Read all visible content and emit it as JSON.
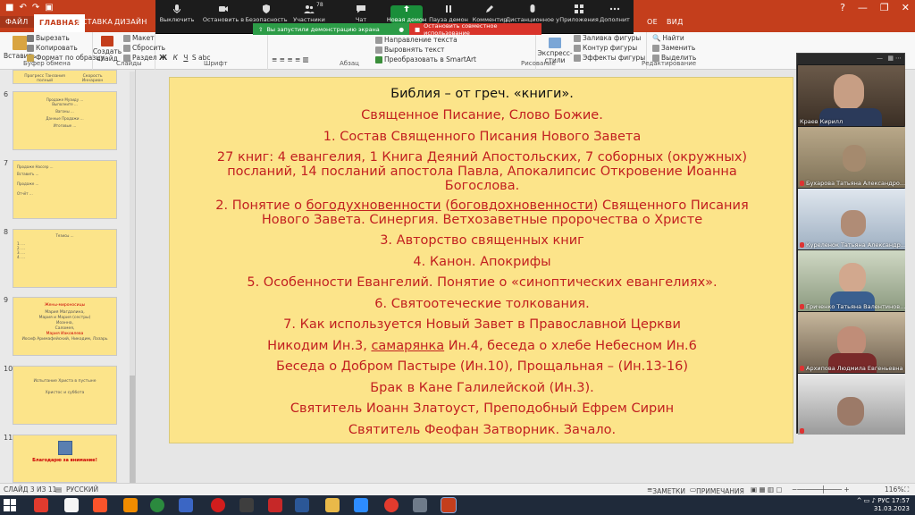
{
  "titlebar": {
    "window_controls": [
      "?",
      "—",
      "❐",
      "✕"
    ]
  },
  "ribbon_tabs": {
    "file": "ФАЙЛ",
    "home": "ГЛАВНАЯ",
    "insert": "ВСТАВКА",
    "design": "ДИЗАЙН",
    "right1": "ОЕ",
    "right2": "ВИД"
  },
  "ribbon": {
    "paste": "Вставить",
    "cut": "Вырезать",
    "copy": "Копировать",
    "format_painter": "Формат по образцу",
    "new_slide": "Создать слайд",
    "layout": "Макет",
    "reset": "Сбросить",
    "section": "Раздел",
    "text_direction": "Направление текста",
    "align_text": "Выровнять текст",
    "smartart": "Преобразовать в SmartArt",
    "shape_fill": "Заливка фигуры",
    "shape_outline": "Контур фигуры",
    "shape_effects": "Эффекты фигуры",
    "quick_styles": "Экспресс-стили",
    "find": "Найти",
    "replace": "Заменить",
    "select": "Выделить"
  },
  "group_labels": {
    "clipboard": "Буфер обмена",
    "slides": "Слайды",
    "font": "Шрифт",
    "paragraph": "Абзац",
    "drawing": "Рисование",
    "editing": "Редактирование"
  },
  "zoom_toolbar": {
    "items": [
      {
        "label": "Выключить"
      },
      {
        "label": "Остановить в"
      },
      {
        "label": "Безопасность"
      },
      {
        "label": "Участники",
        "count": "78"
      },
      {
        "label": "Чат"
      },
      {
        "label": "Новая демон"
      },
      {
        "label": "Пауза демон"
      },
      {
        "label": "Комментир"
      },
      {
        "label": "Дистанционное у"
      },
      {
        "label": "Приложения"
      },
      {
        "label": "Дополнит"
      }
    ],
    "share_notice": "Вы запустили демонстрацию экрана",
    "stop_share": "Остановить совместное использование"
  },
  "thumbnails": [
    {
      "num": "",
      "lines": [
        "Прогресс Танзания полный",
        "Скорость Иннарион"
      ]
    },
    {
      "num": "6",
      "lines": [
        "Продаже Музиду ...",
        "Выполните ...",
        "Вагоны ...",
        "Данные Продажи ...",
        "Итоговые ..."
      ]
    },
    {
      "num": "7",
      "lines": [
        "Продаже Нассер ...",
        "Вставить ...",
        "Продаже ...",
        "Отчёт ..."
      ]
    },
    {
      "num": "8",
      "lines": [
        "Тезисы ...",
        "1. ...",
        "2. ...",
        "3. ...",
        "4. ..."
      ]
    },
    {
      "num": "9",
      "lines": [
        "Жены-мироносицы",
        "Мария Магдалина,",
        "Мария и Мария (сестры)",
        "Иоанна,",
        "Саломея,",
        "Мария Иаковлева",
        "Иосиф Аримафейский, Никодим, Лазарь"
      ]
    },
    {
      "num": "10",
      "lines": [
        "Испытание Христа в пустыне",
        "Христос и суббота"
      ]
    },
    {
      "num": "11",
      "lines": [
        "Благодарю за внимание!"
      ]
    }
  ],
  "slide": {
    "line1": "Библия – от греч. «книги».",
    "line2": "Священное Писание, Слово Божие.",
    "line3": "1. Состав Священного Писания Нового Завета",
    "line4a": "27 книг: 4 евангелия, 1 Книга Деяний Апостольских, 7 соборных (окружных)",
    "line4b": "посланий, 14 посланий апостола Павла, Апокалипсис Откровение Иоанна",
    "line4c": "Богослова.",
    "line5_pre": "2. Понятие о ",
    "line5_u1": "богодухновенности",
    "line5_mid": " (",
    "line5_u2": "боговдохновенности",
    "line5_post": ") Священного Писания",
    "line5b": "Нового Завета. Синергия. Ветхозаветные пророчества о Христе",
    "line6": "3. Авторство священных книг",
    "line7": "4. Канон. Апокрифы",
    "line8": "5. Особенности Евангелий. Понятие о «синоптических евангелиях».",
    "line9": "6. Святоотеческие толкования.",
    "line10": "7. Как используется Новый Завет в Православной Церкви",
    "line11_pre": "Никодим Ин.3, ",
    "line11_u": "самарянка",
    "line11_post": " Ин.4, беседа о хлебе Небесном Ин.6",
    "line12": "Беседа о Добром Пастыре (Ин.10), Прощальная – (Ин.13-16)",
    "line13": "Брак в Кане Галилейской (Ин.3).",
    "line14": "Святитель Иоанн Златоуст, Преподобный Ефрем Сирин",
    "line15": "Святитель Феофан Затворник. Зачало."
  },
  "participants": [
    {
      "name": "Краев Кирилл",
      "muted": false
    },
    {
      "name": "Бухарова Татьяна Александро...",
      "muted": true
    },
    {
      "name": "Куреленок Татьяна Александр...",
      "muted": true
    },
    {
      "name": "Гриченко Татьяна Валентинов...",
      "muted": true
    },
    {
      "name": "Архипова Людмила Евгеньевна",
      "muted": true
    },
    {
      "name": "",
      "muted": true
    }
  ],
  "statusbar": {
    "slide_of": "СЛАЙД 3 ИЗ 11",
    "language": "РУССКИЙ",
    "notes": "ЗАМЕТКИ",
    "comments": "ПРИМЕЧАНИЯ",
    "zoom": "116%"
  },
  "tray": {
    "lang": "РУС",
    "time": "17:57",
    "date": "31.03.2023"
  },
  "colors": {
    "accent": "#c43e1c",
    "slide_bg": "#fce48a",
    "slide_red": "#c22020"
  }
}
